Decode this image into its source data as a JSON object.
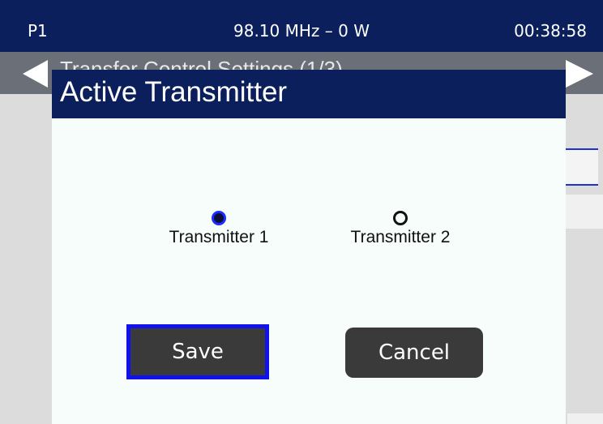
{
  "status_bar": {
    "preset": "P1",
    "frequency_power": "98.10 MHz – 0 W",
    "clock": "00:38:58"
  },
  "background_page": {
    "title_partial": "Transfer Control Settings (1/3)"
  },
  "dialog": {
    "title": "Active Transmitter",
    "options": [
      {
        "label": "Transmitter 1",
        "selected": true
      },
      {
        "label": "Transmitter 2",
        "selected": false
      }
    ],
    "save_label": "Save",
    "cancel_label": "Cancel"
  },
  "colors": {
    "header_navy": "#0b1f5c",
    "focus_blue": "#1111ee",
    "button_dark": "#3a3a3a",
    "dialog_bg": "#f6fdfa"
  }
}
